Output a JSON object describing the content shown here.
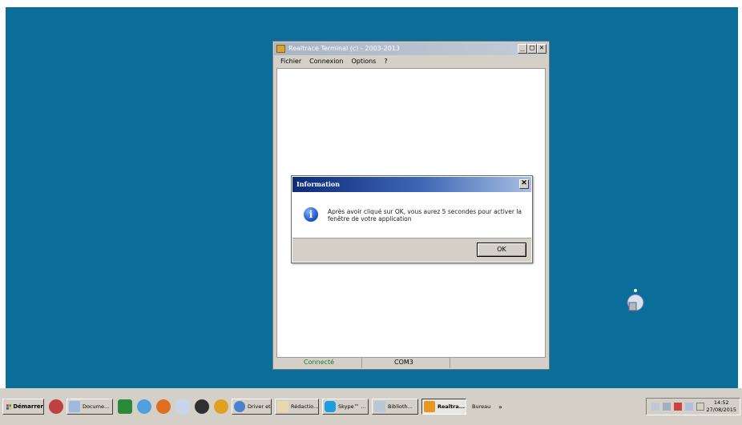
{
  "main_window": {
    "title": "Realtrace Terminal (c) - 2003-2013",
    "menu": [
      "Fichier",
      "Connexion",
      "Options",
      "?"
    ],
    "status": {
      "connection": "Connecté",
      "port": "COM3"
    },
    "buttons": {
      "minimize": "_",
      "maximize": "□",
      "close": "✕"
    }
  },
  "dialog": {
    "title": "Information",
    "message": "Après avoir cliqué sur OK, vous aurez 5 secondes pour activer la fenêtre de votre application",
    "ok_label": "OK",
    "close": "✕",
    "info_glyph": "i"
  },
  "taskbar": {
    "start_label": "Démarrer",
    "tasks": [
      {
        "label": "Docume...",
        "icon_color": "#9fb8e0"
      },
      {
        "label": "Driver et...",
        "icon_color": "#4a80d0"
      },
      {
        "label": "Rédactio...",
        "icon_color": "#e8d8b0"
      },
      {
        "label": "Skype™ ...",
        "icon_color": "#18a0e0"
      },
      {
        "label": "Biblioth...",
        "icon_color": "#b8c8d8"
      },
      {
        "label": "Realtra...",
        "icon_color": "#e89820"
      },
      {
        "label": "Bureau",
        "icon_color": "#d4d0c8"
      }
    ],
    "clock_time": "14:52",
    "clock_date": "27/08/2015",
    "tray_chevron": "»"
  },
  "colors": {
    "desktop": "#0a6d9a",
    "taskbar": "#d4d0c8"
  }
}
